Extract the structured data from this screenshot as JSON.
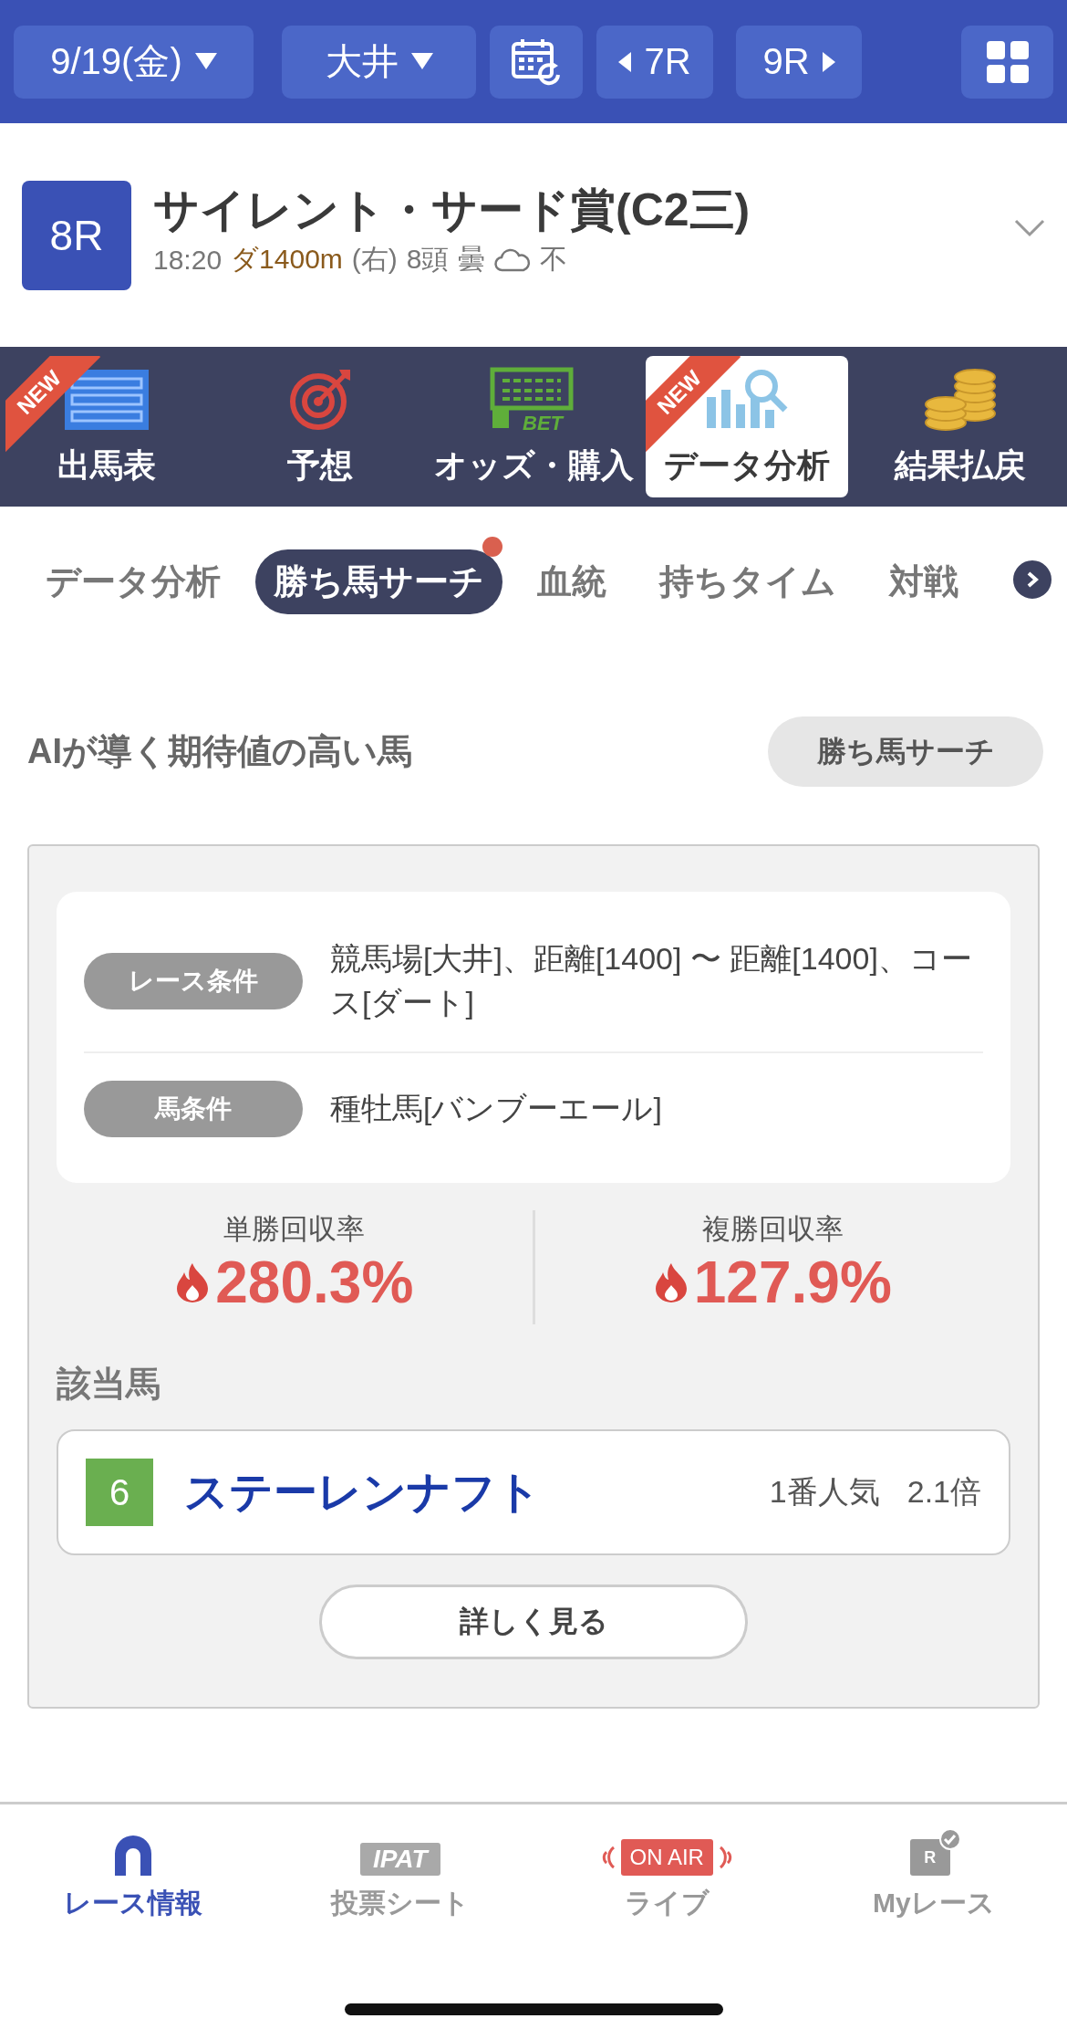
{
  "top_bar": {
    "date": "9/19(金)",
    "venue": "大井",
    "prev_race": "7R",
    "next_race": "9R"
  },
  "race": {
    "number": "8R",
    "title": "サイレント・サード賞(C2三)",
    "time": "18:20",
    "course": "ダ1400m",
    "direction": "(右)",
    "runners": "8頭",
    "weather": "曇",
    "going": "不"
  },
  "main_tabs": [
    {
      "label": "出馬表",
      "badge": "NEW",
      "selected": false
    },
    {
      "label": "予想",
      "selected": false
    },
    {
      "label": "オッズ・購入",
      "icon_text": "BET",
      "selected": false
    },
    {
      "label": "データ分析",
      "badge": "NEW",
      "selected": true
    },
    {
      "label": "結果払戻",
      "selected": false
    }
  ],
  "sub_tabs": [
    {
      "label": "データ分析",
      "selected": false,
      "dot": false
    },
    {
      "label": "勝ち馬サーチ",
      "selected": true,
      "dot": true
    },
    {
      "label": "血統",
      "selected": false,
      "dot": false
    },
    {
      "label": "持ちタイム",
      "selected": false,
      "dot": false
    },
    {
      "label": "対戦",
      "selected": false,
      "dot": false
    }
  ],
  "search": {
    "heading": "AIが導く期待値の高い馬",
    "button": "勝ち馬サーチ",
    "conditions": [
      {
        "label": "レース条件",
        "value": "競馬場[大井]、距離[1400] 〜 距離[1400]、コース[ダート]"
      },
      {
        "label": "馬条件",
        "value": "種牡馬[バンブーエール]"
      }
    ],
    "stats": [
      {
        "label": "単勝回収率",
        "value": "280.3%"
      },
      {
        "label": "複勝回収率",
        "value": "127.9%"
      }
    ],
    "horses_heading": "該当馬",
    "horses": [
      {
        "number": "6",
        "color": "#6aaf50",
        "name": "ステーレンナフト",
        "popularity": "1番人気",
        "odds": "2.1倍"
      }
    ],
    "details_button": "詳しく見る"
  },
  "bottom_nav": [
    {
      "label": "レース情報",
      "selected": true
    },
    {
      "label": "投票シート",
      "icon_text": "IPAT",
      "selected": false
    },
    {
      "label": "ライブ",
      "icon_text": "ON AIR",
      "selected": false
    },
    {
      "label": "Myレース",
      "icon_text": "R",
      "selected": false
    }
  ]
}
